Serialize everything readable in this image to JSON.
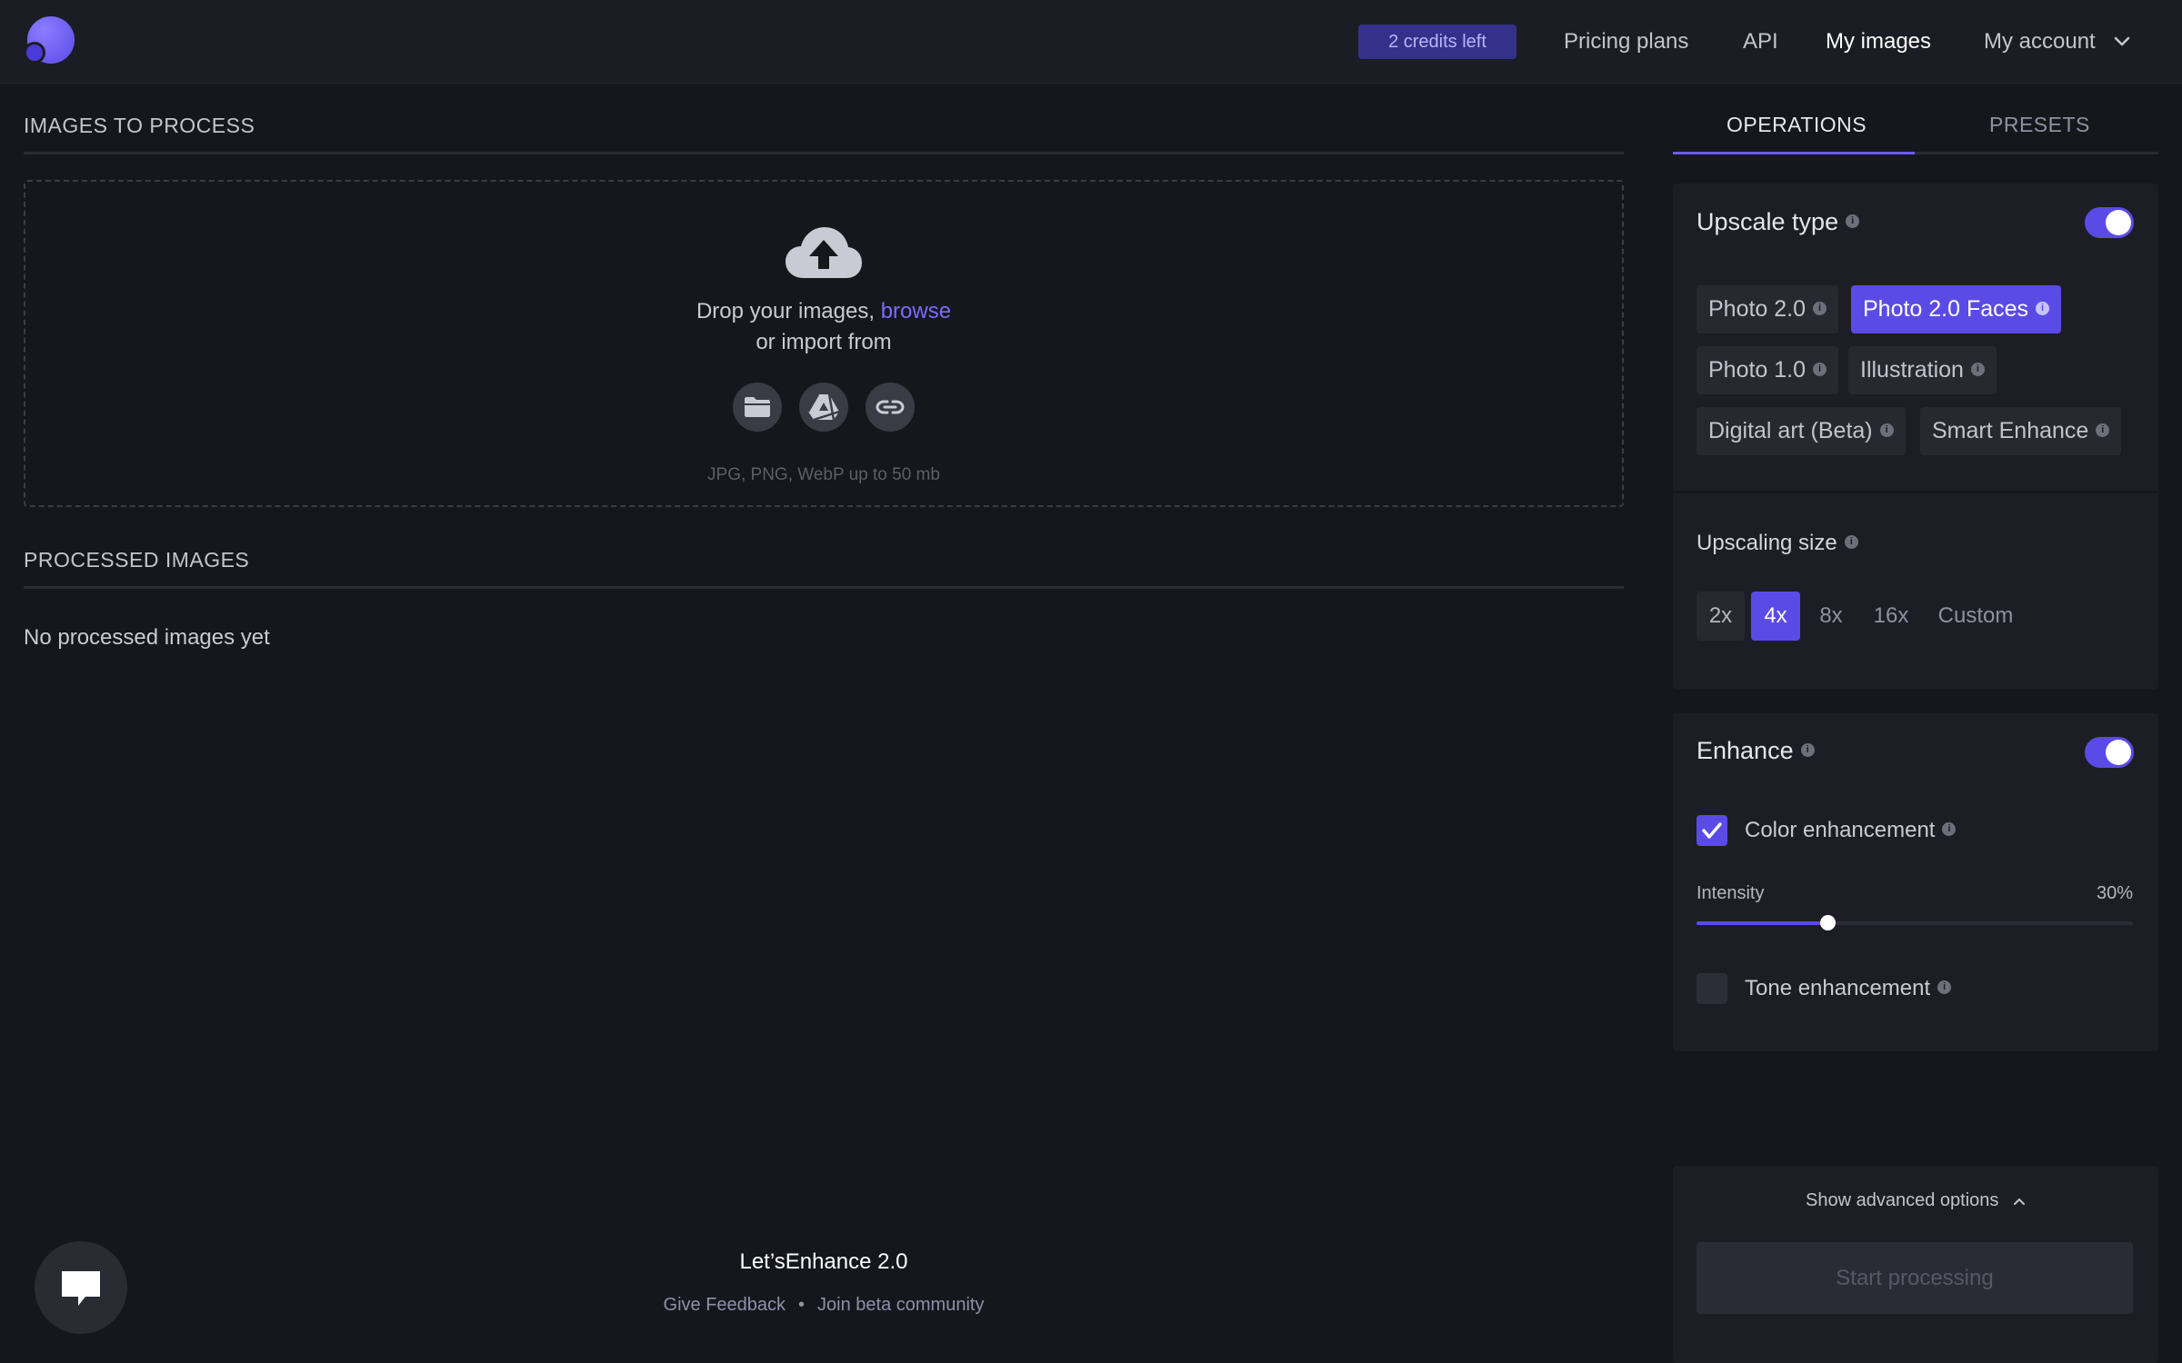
{
  "header": {
    "credits_badge": "2 credits left",
    "nav": [
      {
        "label": "Pricing plans"
      },
      {
        "label": "API"
      },
      {
        "label": "My images",
        "active": true
      },
      {
        "label": "My account"
      }
    ]
  },
  "left": {
    "to_process_title": "IMAGES TO PROCESS",
    "drop_text": "Drop your images,",
    "browse_link": "browse",
    "import_text": "or import from",
    "import_sources": [
      "folder-icon",
      "google-drive-icon",
      "link-icon"
    ],
    "formats_hint": "JPG, PNG, WebP up to 50 mb",
    "processed_title": "PROCESSED IMAGES",
    "empty_text": "No processed images yet"
  },
  "footer": {
    "title": "Let’sEnhance 2.0",
    "feedback_link": "Give Feedback",
    "separator": "•",
    "community_link": "Join beta community"
  },
  "right": {
    "tabs": [
      {
        "label": "OPERATIONS",
        "active": true
      },
      {
        "label": "PRESETS",
        "active": false
      }
    ],
    "upscale": {
      "title": "Upscale type",
      "enabled": true,
      "types": [
        {
          "label": "Photo 2.0",
          "selected": false
        },
        {
          "label": "Photo 2.0 Faces",
          "selected": true
        },
        {
          "label": "Photo 1.0",
          "selected": false
        },
        {
          "label": "Illustration",
          "selected": false
        },
        {
          "label": "Digital art (Beta)",
          "selected": false
        },
        {
          "label": "Smart Enhance",
          "selected": false
        }
      ],
      "size_title": "Upscaling size",
      "sizes": [
        "2x",
        "4x",
        "8x",
        "16x",
        "Custom"
      ],
      "selected_size": "4x"
    },
    "enhance": {
      "title": "Enhance",
      "enabled": true,
      "color_enhancement": {
        "label": "Color enhancement",
        "checked": true
      },
      "intensity": {
        "label": "Intensity",
        "value_text": "30%",
        "value": 0.3
      },
      "tone_enhancement": {
        "label": "Tone enhancement",
        "checked": false
      }
    },
    "advanced_label": "Show advanced options",
    "start_button": "Start processing"
  },
  "colors": {
    "accent": "#5b4be6",
    "background": "#16171d",
    "panel": "#1d1e25"
  }
}
